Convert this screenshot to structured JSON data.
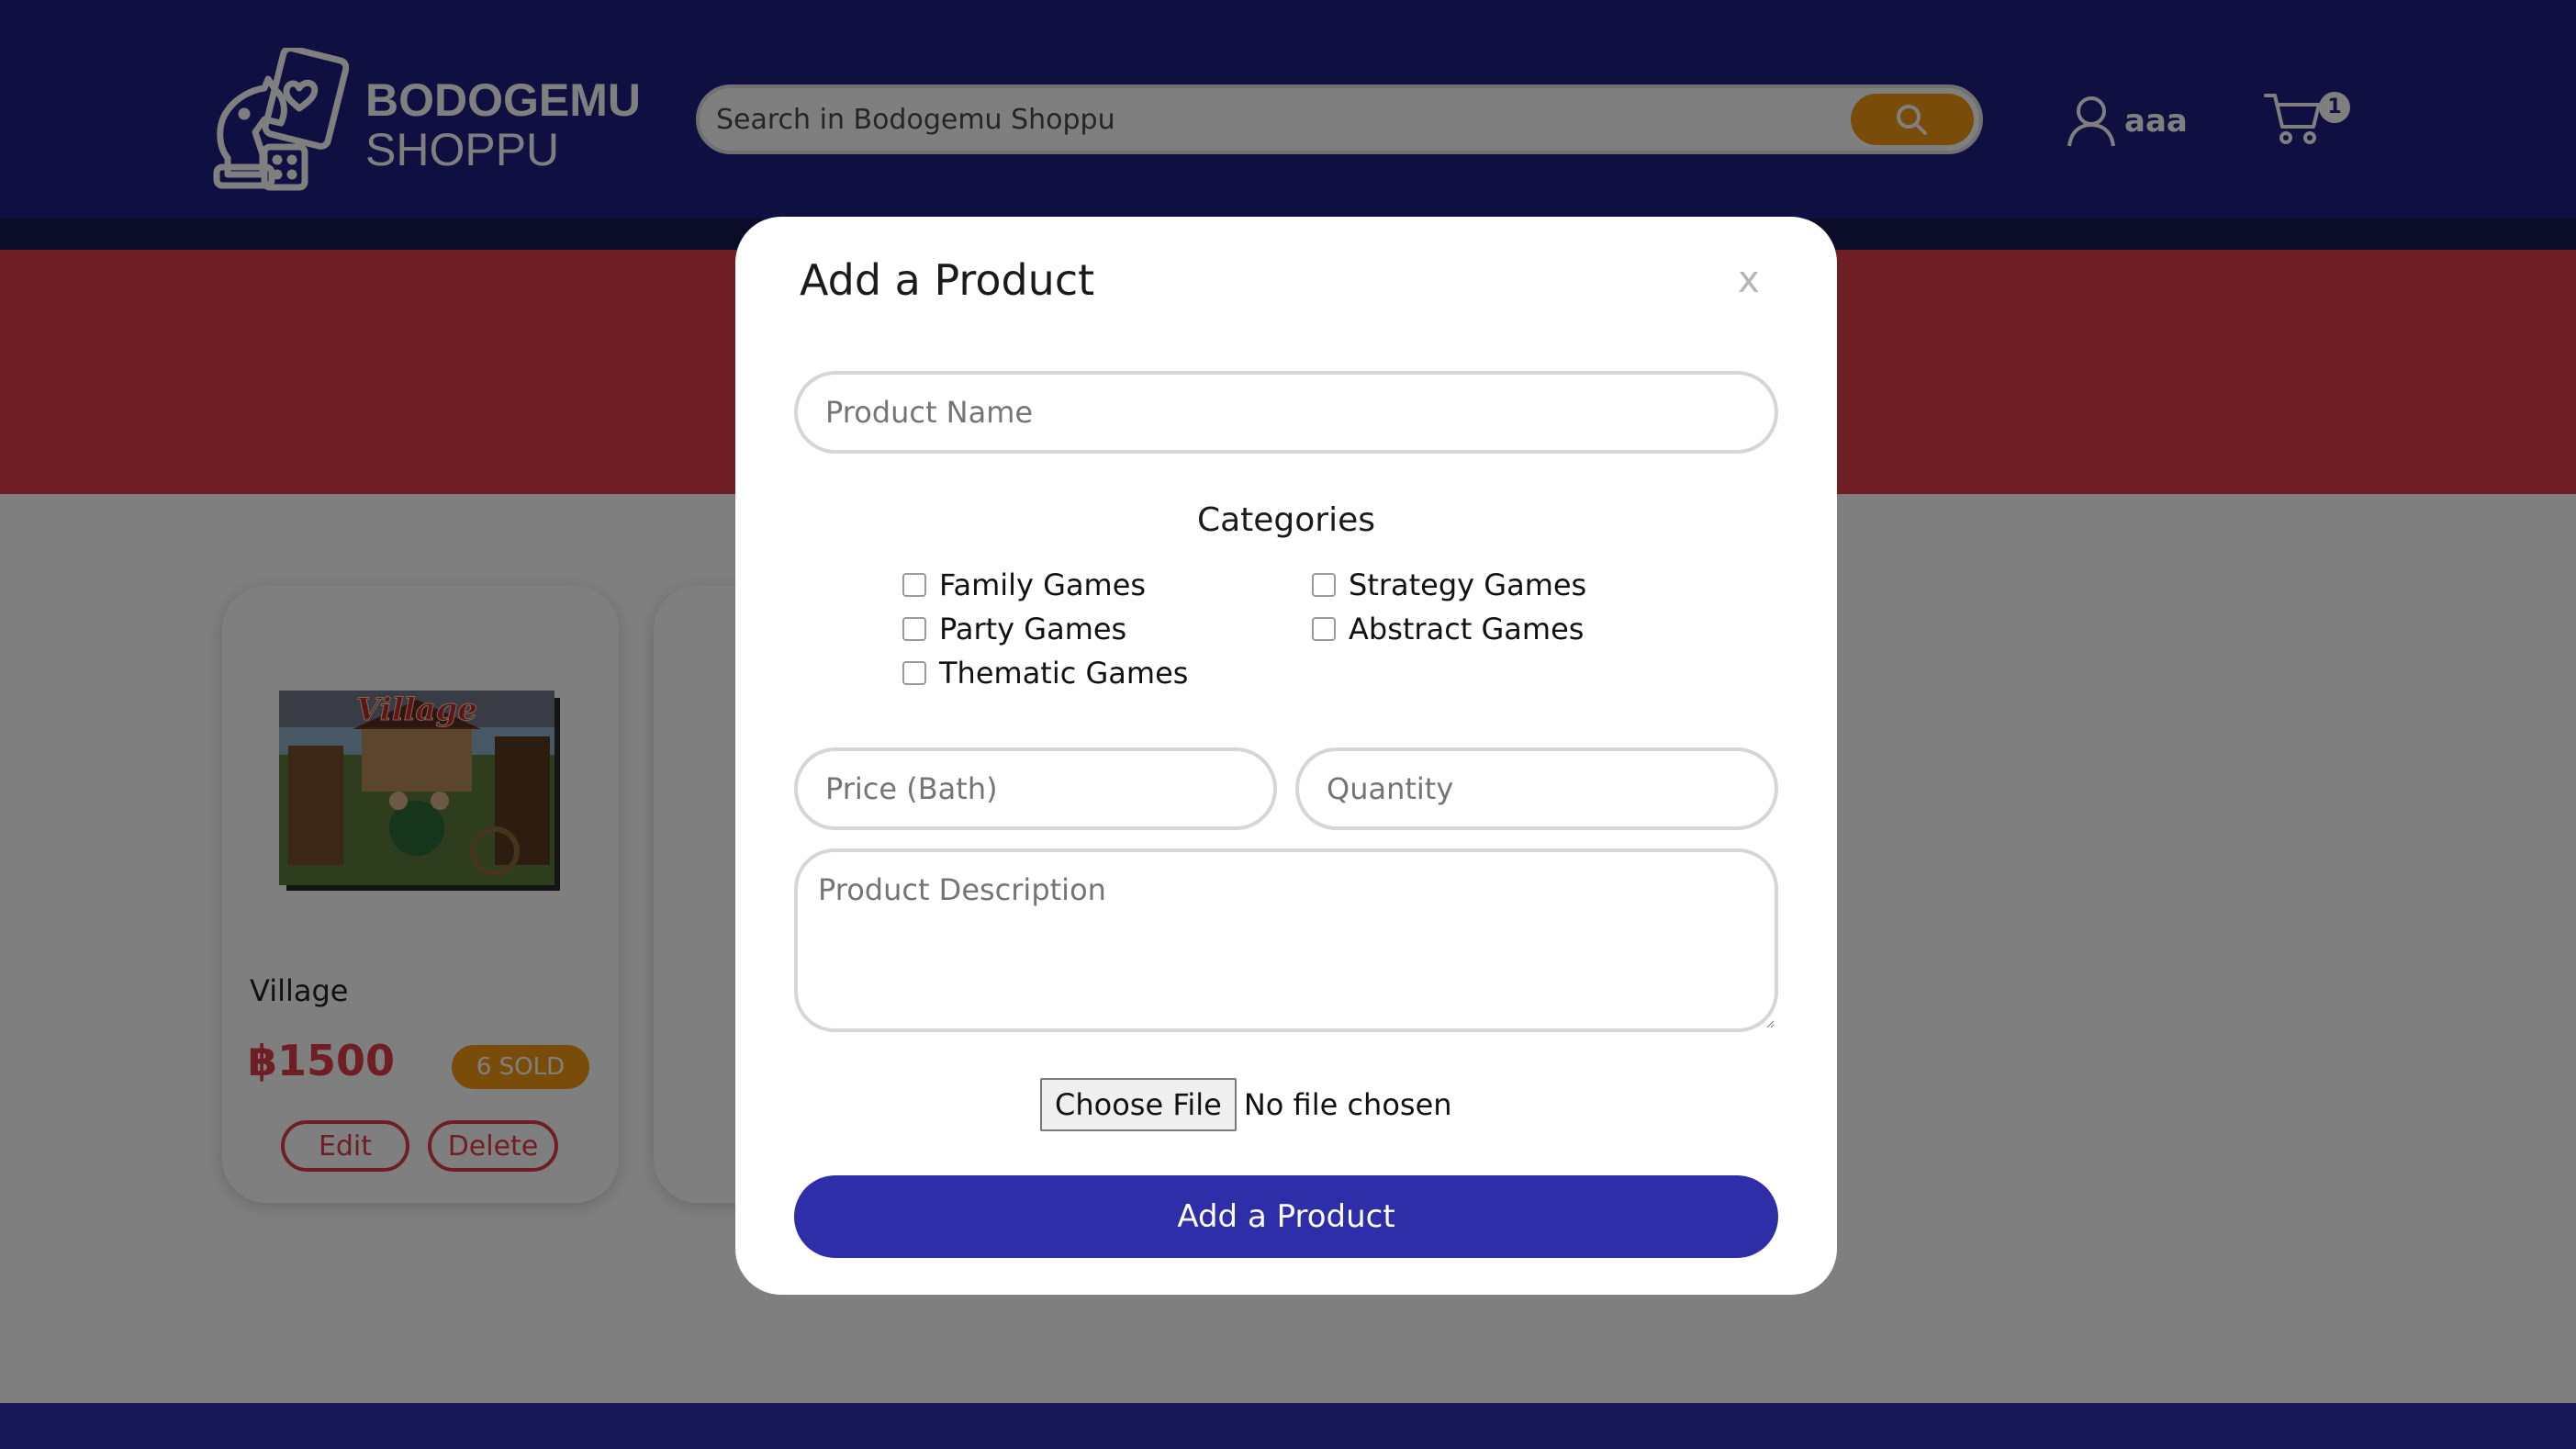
{
  "header": {
    "logo": {
      "line1": "BODOGEMU",
      "line2": "SHOPPU"
    },
    "search": {
      "placeholder": "Search in Bodogemu Shoppu",
      "button_icon": "search-icon"
    },
    "user": {
      "name": "aaa",
      "icon": "user-icon"
    },
    "cart": {
      "count": "1",
      "icon": "cart-icon"
    }
  },
  "products": [
    {
      "name": "Village",
      "price": "฿1500",
      "sold": "6 SOLD",
      "edit_label": "Edit",
      "delete_label": "Delete"
    }
  ],
  "modal": {
    "title": "Add a Product",
    "close_label": "x",
    "product_name_placeholder": "Product Name",
    "categories_title": "Categories",
    "categories": [
      {
        "label": "Family Games",
        "checked": false
      },
      {
        "label": "Strategy Games",
        "checked": false
      },
      {
        "label": "Party Games",
        "checked": false
      },
      {
        "label": "Abstract Games",
        "checked": false
      },
      {
        "label": "Thematic Games",
        "checked": false
      }
    ],
    "price_placeholder": "Price (Bath)",
    "quantity_placeholder": "Quantity",
    "description_placeholder": "Product Description",
    "file": {
      "button_label": "Choose File",
      "status": "No file chosen"
    },
    "submit_label": "Add a Product"
  },
  "colors": {
    "header": "#1f2082",
    "banner": "#e03d4a",
    "accent": "#f29a13",
    "primary_button": "#2d2ea8"
  }
}
